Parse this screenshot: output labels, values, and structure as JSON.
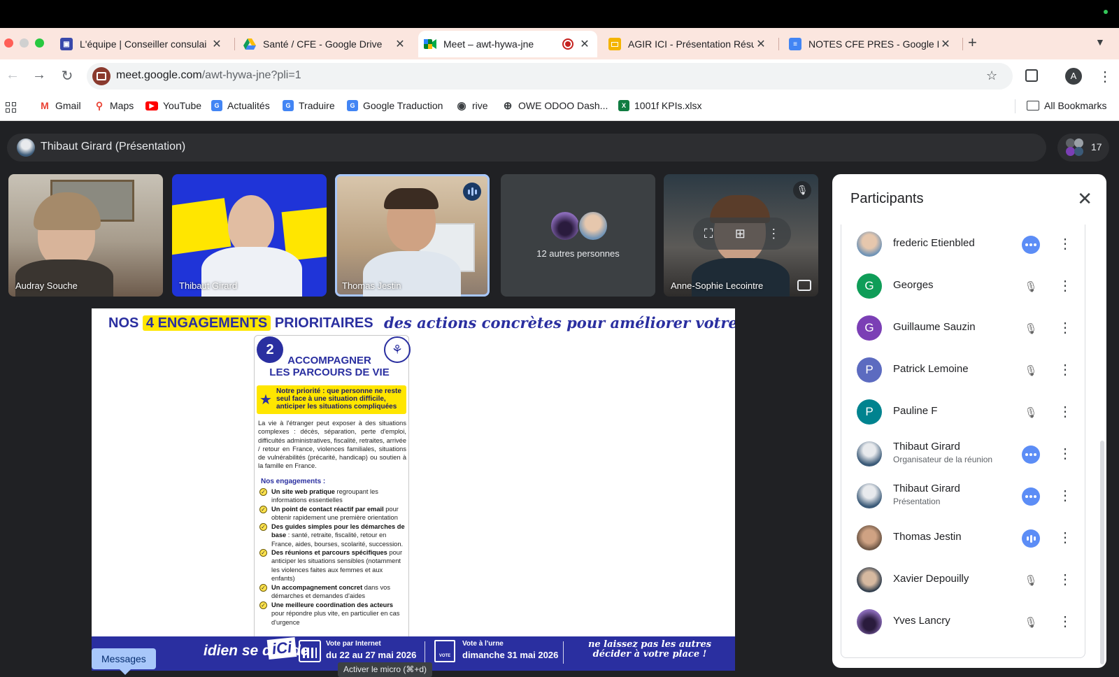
{
  "browser": {
    "tabs": [
      {
        "title": "L'équipe | Conseiller consulai",
        "favicon": "site-icon"
      },
      {
        "title": "Santé / CFE - Google Drive",
        "favicon": "google-drive-icon"
      },
      {
        "title": "Meet – awt-hywa-jne",
        "favicon": "google-meet-icon",
        "active": true,
        "recording": true
      },
      {
        "title": "AGIR ICI - Présentation Résult",
        "favicon": "google-slides-icon"
      },
      {
        "title": "NOTES CFE PRES - Google D",
        "favicon": "google-docs-icon"
      }
    ],
    "url_domain": "meet.google.com",
    "url_path": "/awt-hywa-jne?pli=1",
    "profile_initial": "A",
    "bookmarks": [
      "Gmail",
      "Maps",
      "YouTube",
      "Actualités",
      "Traduire",
      "Google Traduction",
      "rive",
      "OWE ODOO Dash...",
      "1001f KPIs.xlsx"
    ],
    "all_bookmarks": "All Bookmarks"
  },
  "meet": {
    "presenter_label": "Thibaut Girard (Présentation)",
    "participant_count": "17",
    "tiles": [
      {
        "name": "Audray Souche"
      },
      {
        "name": "Thibaut Girard"
      },
      {
        "name": "Thomas Jestin",
        "speaking": true
      },
      {
        "name": "12 autres personnes"
      },
      {
        "name": "Anne-Sophie Lecointre",
        "muted": true
      }
    ],
    "messages_tooltip": "Messages",
    "mic_tooltip": "Activer le micro (⌘+d)"
  },
  "slide": {
    "title_pre": "NOS",
    "title_highlight": "4 ENGAGEMENTS",
    "title_post": "PRIORITAIRES",
    "subtitle": "des actions concrètes pour améliorer votre quotidien !",
    "card_number": "2",
    "card_title_1": "ACCOMPAGNER",
    "card_title_2": "LES PARCOURS DE VIE",
    "priority": "Notre priorité : que personne ne reste seul face à une situation difficile, anticiper les situations compliquées",
    "body": "La vie à l'étranger peut exposer à des situations complexes : décès, séparation, perte d'emploi, difficultés administratives, fiscalité, retraites, arrivée / retour en France, violences familiales, situations de vulnérabilités (précarité, handicap) ou soutien à la famille en France.",
    "engagements_heading": "Nos engagements :",
    "engagements": [
      {
        "bold": "Un site web pratique",
        "rest": " regroupant les informations essentielles"
      },
      {
        "bold": "Un point de contact réactif par email",
        "rest": " pour obtenir rapidement une première orientation"
      },
      {
        "bold": "Des guides simples pour les démarches de base",
        "rest": " : santé, retraite, fiscalité, retour en France, aides, bourses, scolarité, succession."
      },
      {
        "bold": "Des réunions et parcours spécifiques",
        "rest": " pour anticiper les situations sensibles (notamment les violences faites aux femmes et aux enfants)"
      },
      {
        "bold": "Un accompagnement concret",
        "rest": " dans vos démarches et demandes d'aides"
      },
      {
        "bold": "Une meilleure coordination des acteurs",
        "rest": " pour répondre plus vite, en particulier en cas d'urgence"
      }
    ],
    "footer_left": "idien se décide",
    "footer_ici": "iCi",
    "footer_vote_internet_label": "Vote par Internet",
    "footer_vote_internet_dates": "du 22 au 27 mai 2026",
    "footer_vote_box": "VOTE",
    "footer_vote_urne_label": "Vote à l'urne",
    "footer_vote_urne_date": "dimanche 31 mai 2026",
    "footer_slogan": "ne laissez pas les autres décider à votre place !",
    "colors": {
      "navy": "#2a2fa0",
      "yellow": "#ffe600"
    }
  },
  "participants_panel": {
    "title": "Participants",
    "list": [
      {
        "name": "frederic Etienbled",
        "status": "more"
      },
      {
        "name": "Georges",
        "initial": "G",
        "status": "muted",
        "color": "#0f9d58"
      },
      {
        "name": "Guillaume Sauzin",
        "initial": "G",
        "status": "muted",
        "color": "#7b3fb5"
      },
      {
        "name": "Patrick Lemoine",
        "initial": "P",
        "status": "muted",
        "color": "#5c6bc0"
      },
      {
        "name": "Pauline F",
        "initial": "P",
        "status": "muted",
        "color": "#00838f"
      },
      {
        "name": "Thibaut Girard",
        "sub": "Organisateur de la réunion",
        "status": "more"
      },
      {
        "name": "Thibaut Girard",
        "sub": "Présentation",
        "status": "more"
      },
      {
        "name": "Thomas Jestin",
        "status": "speaking"
      },
      {
        "name": "Xavier Depouilly",
        "status": "muted"
      },
      {
        "name": "Yves Lancry",
        "status": "muted"
      }
    ]
  }
}
